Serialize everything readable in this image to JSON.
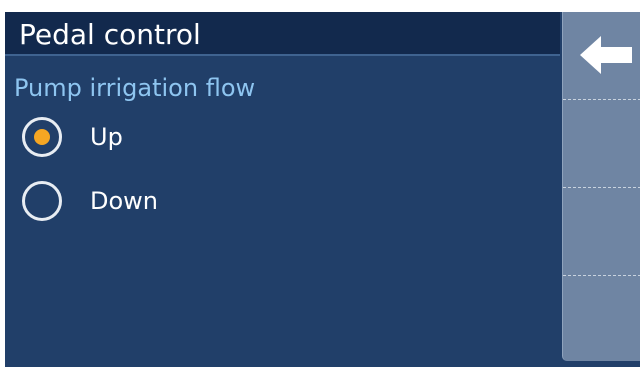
{
  "header": {
    "title": "Pedal control"
  },
  "section": {
    "label": "Pump irrigation flow"
  },
  "options": [
    {
      "label": "Up",
      "selected": true
    },
    {
      "label": "Down",
      "selected": false
    }
  ],
  "side_panel": {
    "buttons": [
      {
        "icon": "arrow-left-icon"
      },
      {
        "icon": ""
      },
      {
        "icon": ""
      },
      {
        "icon": ""
      }
    ]
  },
  "colors": {
    "background": "#213f69",
    "header": "#12294d",
    "accent_label": "#8ec5f0",
    "radio_selected": "#f5a623",
    "side_panel": "#6f85a3"
  }
}
